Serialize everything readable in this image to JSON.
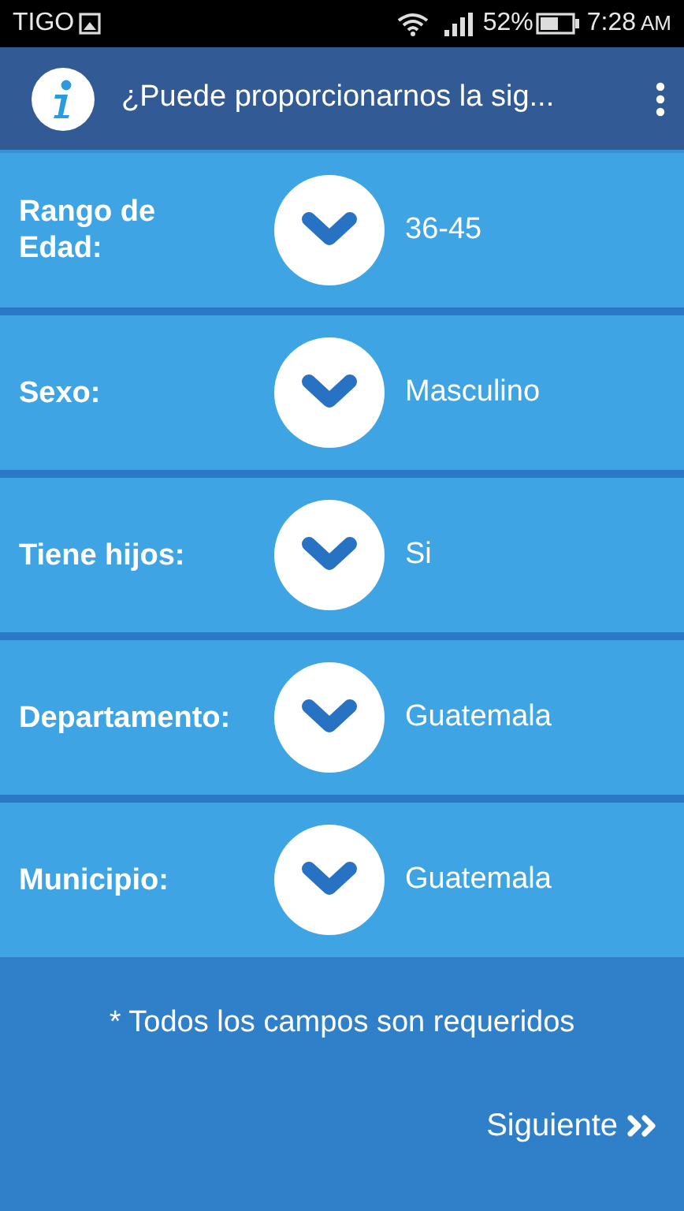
{
  "status_bar": {
    "carrier": "TIGO",
    "battery": "52%",
    "time": "7:28",
    "meridiem": "AM"
  },
  "app_bar": {
    "title": "¿Puede proporcionarnos la sig..."
  },
  "fields": [
    {
      "label": "Rango de Edad:",
      "value": "36-45"
    },
    {
      "label": "Sexo:",
      "value": "Masculino"
    },
    {
      "label": "Tiene hijos:",
      "value": "Si"
    },
    {
      "label": "Departamento:",
      "value": "Guatemala"
    },
    {
      "label": "Municipio:",
      "value": "Guatemala"
    }
  ],
  "note": "* Todos los campos son requeridos",
  "next_button": {
    "label": "Siguiente"
  }
}
